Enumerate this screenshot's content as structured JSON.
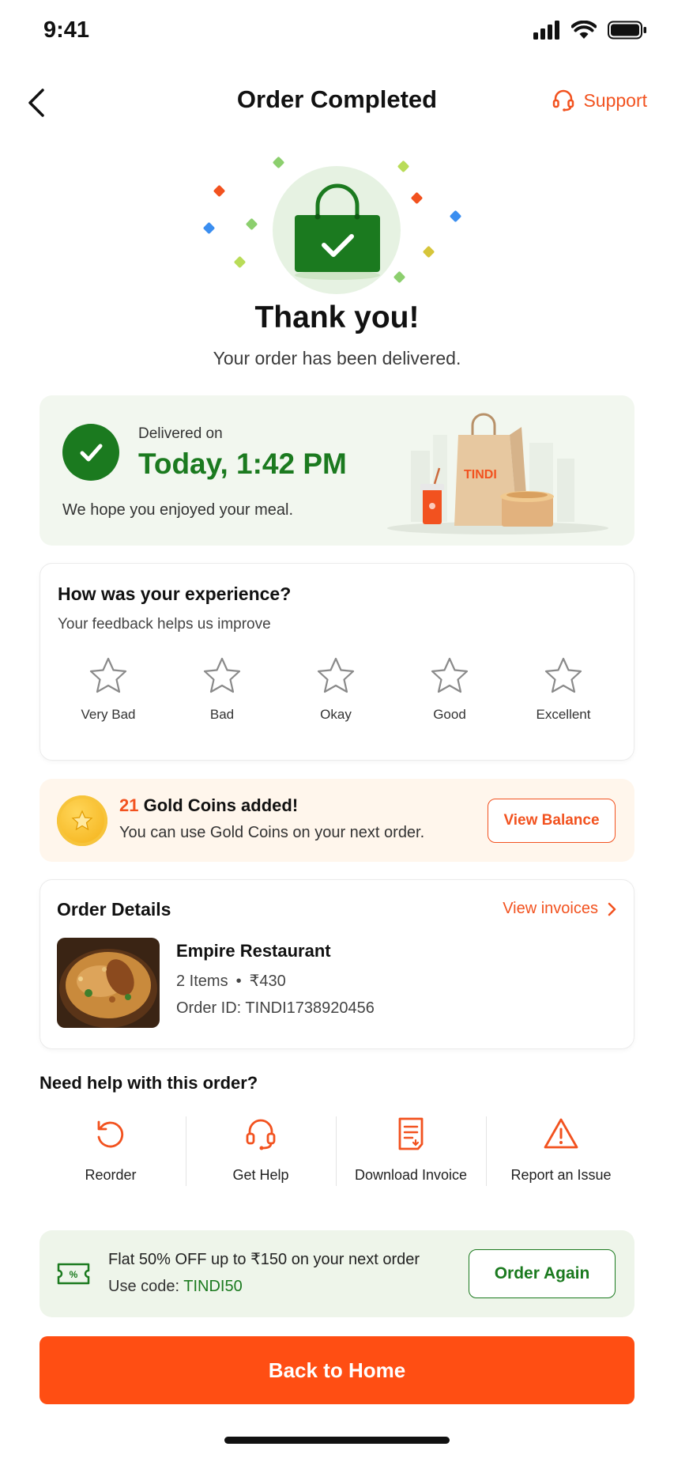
{
  "status_bar": {
    "time": "9:41"
  },
  "header": {
    "title": "Order Completed",
    "support_label": "Support"
  },
  "hero": {
    "title": "Thank you!",
    "subtitle": "Your order has been delivered."
  },
  "delivery": {
    "label": "Delivered on",
    "time": "Today, 1:42 PM",
    "message": "We hope you enjoyed your meal.",
    "bag_brand": "TINDI"
  },
  "rating": {
    "title": "How was your experience?",
    "subtitle": "Your feedback helps us improve",
    "options": [
      "Very Bad",
      "Bad",
      "Okay",
      "Good",
      "Excellent"
    ]
  },
  "coins": {
    "count": "21",
    "title_suffix": " Gold Coins added!",
    "subtitle": "You can use Gold Coins on your next order.",
    "button_label": "View Balance"
  },
  "order": {
    "title": "Order Details",
    "view_invoices_label": "View invoices",
    "restaurant": "Empire Restaurant",
    "items": "2 Items",
    "separator": "•",
    "price": "₹430",
    "order_id": "Order ID: TINDI1738920456"
  },
  "help": {
    "title": "Need help with this order?",
    "actions": [
      "Reorder",
      "Get Help",
      "Download Invoice",
      "Report an Issue"
    ]
  },
  "promo": {
    "title": "Flat 50% OFF up to ₹150 on your next order",
    "code_prefix": "Use code: ",
    "code": "TINDI50",
    "button_label": "Order Again"
  },
  "footer": {
    "button_label": "Back to Home"
  },
  "colors": {
    "accent": "#f2521f",
    "primary_button": "#ff4e13",
    "success_green": "#1b7a1f",
    "coins_bg": "#fff6ec",
    "promo_bg": "#eef5ea"
  }
}
